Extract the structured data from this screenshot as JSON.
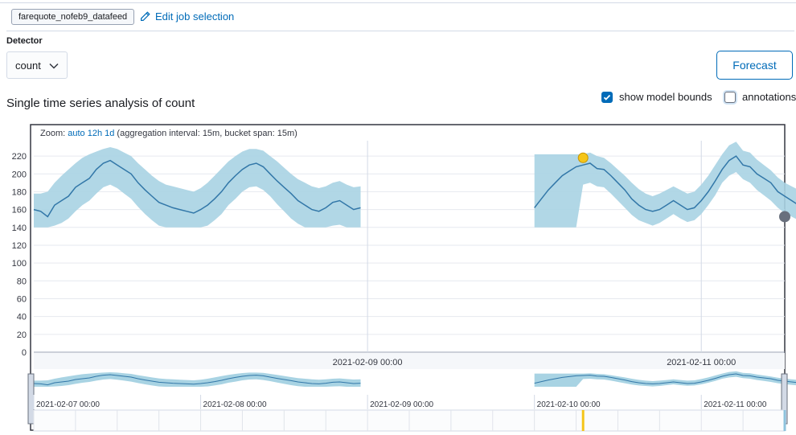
{
  "job": {
    "badge": "farequote_nofeb9_datafeed",
    "edit_label": "Edit job selection"
  },
  "detector": {
    "label": "Detector",
    "selected": "count"
  },
  "forecast_button": "Forecast",
  "title": "Single time series analysis of count",
  "options": {
    "show_model_bounds": {
      "label": "show model bounds",
      "checked": true
    },
    "annotations": {
      "label": "annotations",
      "checked": false
    }
  },
  "zoom": {
    "prefix": "Zoom:",
    "options": [
      "auto",
      "12h",
      "1d"
    ],
    "info": "(aggregation interval: 15m, bucket span: 15m)"
  },
  "colors": {
    "line": "#3277a8",
    "bounds": "#a8d3e3",
    "anomaly": "#f5c518",
    "accent": "#006bb8"
  },
  "chart_data": {
    "type": "line",
    "ylabel": "count",
    "ylim": [
      0,
      230
    ],
    "yticks": [
      0,
      20,
      40,
      60,
      80,
      100,
      120,
      140,
      160,
      180,
      200,
      220
    ],
    "xlim": [
      "2021-02-07 00:00",
      "2021-02-11 12:00"
    ],
    "main_xlim": [
      "2021-02-07 00:00",
      "2021-02-11 12:00"
    ],
    "main_xticks": [
      "2021-02-09 00:00",
      "2021-02-11 00:00"
    ],
    "context_xticks": [
      "2021-02-07 00:00",
      "2021-02-08 00:00",
      "2021-02-09 00:00",
      "2021-02-10 00:00",
      "2021-02-11 00:00"
    ],
    "gap": [
      "2021-02-09 00:00",
      "2021-02-10 00:00"
    ],
    "series_sampled_hourly": [
      {
        "start": "2021-02-07 00:00",
        "values": [
          160,
          158,
          152,
          165,
          170,
          175,
          185,
          190,
          195,
          205,
          212,
          215,
          210,
          205,
          200,
          190,
          182,
          175,
          168,
          165,
          162,
          160,
          158,
          156,
          160,
          165,
          172,
          180,
          190,
          198,
          205,
          210,
          212,
          208,
          200,
          192,
          185,
          178,
          170,
          165,
          160,
          158,
          162,
          168,
          170,
          165,
          160,
          162
        ],
        "lower": [
          140,
          140,
          140,
          142,
          145,
          150,
          158,
          165,
          170,
          178,
          185,
          188,
          184,
          178,
          172,
          163,
          155,
          148,
          142,
          140,
          140,
          140,
          140,
          140,
          140,
          142,
          148,
          155,
          165,
          172,
          180,
          185,
          186,
          182,
          175,
          166,
          158,
          150,
          144,
          140,
          140,
          140,
          140,
          142,
          143,
          140,
          140,
          140
        ],
        "upper": [
          178,
          178,
          180,
          190,
          198,
          205,
          212,
          218,
          222,
          225,
          228,
          230,
          228,
          224,
          220,
          212,
          205,
          198,
          192,
          188,
          186,
          184,
          182,
          180,
          184,
          190,
          198,
          206,
          214,
          220,
          225,
          228,
          228,
          226,
          220,
          214,
          207,
          200,
          194,
          190,
          186,
          184,
          186,
          190,
          192,
          188,
          185,
          186
        ]
      },
      {
        "start": "2021-02-10 00:00",
        "values": [
          162,
          172,
          182,
          190,
          198,
          203,
          208,
          210,
          212,
          206,
          205,
          198,
          190,
          182,
          172,
          165,
          160,
          158,
          160,
          165,
          170,
          165,
          160,
          162,
          170,
          180,
          192,
          205,
          215,
          220,
          210,
          208,
          200,
          195,
          190,
          180,
          175,
          170,
          165,
          160
        ],
        "lower": [
          140,
          140,
          140,
          140,
          140,
          140,
          140,
          188,
          190,
          186,
          185,
          178,
          170,
          162,
          154,
          148,
          145,
          142,
          145,
          150,
          155,
          150,
          146,
          148,
          155,
          165,
          176,
          190,
          198,
          202,
          194,
          190,
          182,
          176,
          170,
          162,
          156,
          152,
          148,
          145
        ],
        "upper": [
          222,
          222,
          222,
          222,
          222,
          222,
          222,
          222,
          224,
          220,
          218,
          212,
          205,
          198,
          190,
          183,
          178,
          175,
          178,
          182,
          186,
          182,
          178,
          180,
          188,
          198,
          210,
          222,
          232,
          236,
          226,
          224,
          216,
          210,
          204,
          196,
          190,
          186,
          182,
          178
        ]
      }
    ],
    "anomalies": [
      {
        "time": "2021-02-10 07:00",
        "value": 218,
        "severity": "minor"
      },
      {
        "time": "2021-02-11 12:00",
        "value": 152,
        "severity": "low"
      }
    ]
  }
}
